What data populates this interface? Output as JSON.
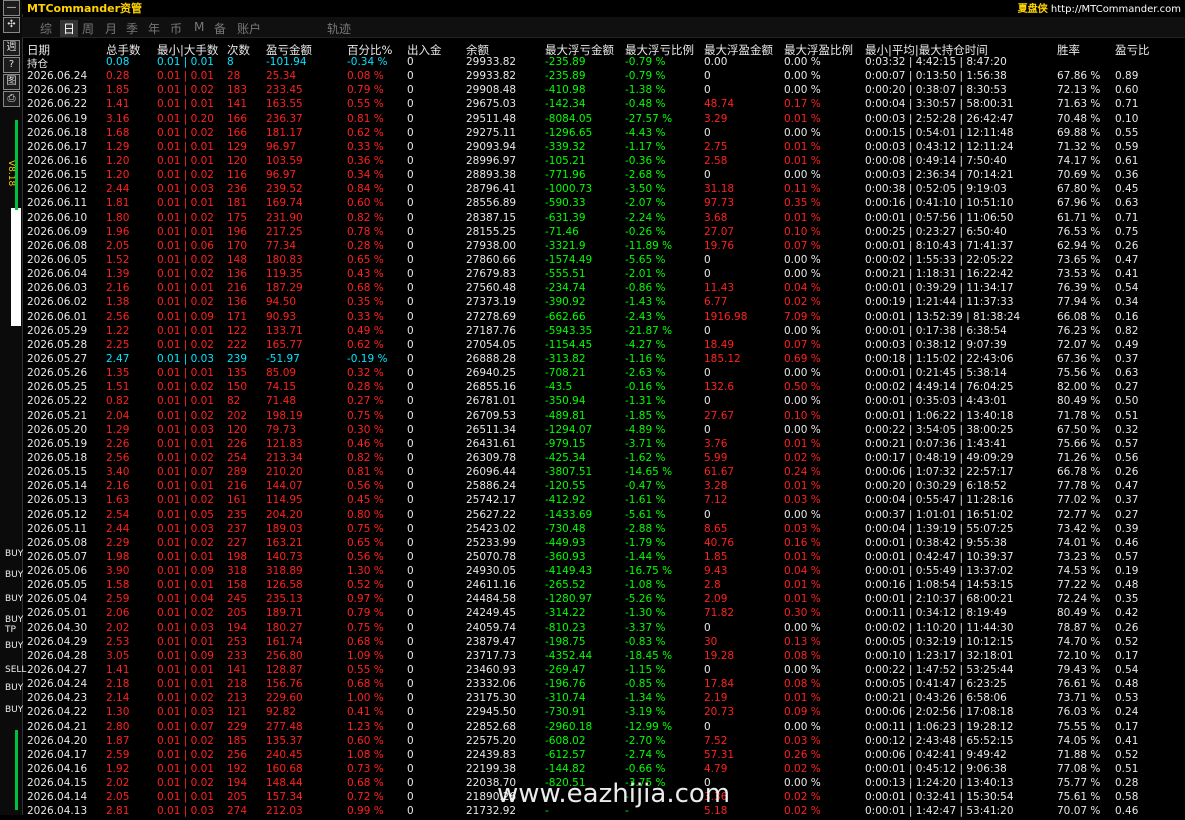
{
  "app": {
    "brand": "MTCommander资管",
    "brand_right_cn": "夏盘侠",
    "brand_right_url": "http://MTCommander.com"
  },
  "tabs": [
    {
      "label": "综",
      "active": false
    },
    {
      "label": "日",
      "active": true
    },
    {
      "label": "周",
      "active": false
    },
    {
      "label": "月",
      "active": false
    },
    {
      "label": "季",
      "active": false
    },
    {
      "label": "年",
      "active": false
    },
    {
      "label": "币",
      "active": false
    },
    {
      "label": "M",
      "active": false
    },
    {
      "label": "备",
      "active": false
    },
    {
      "label": "账户",
      "active": false
    }
  ],
  "extra_tab": "轨迹",
  "sidebar": {
    "version": "V8.18",
    "buttons": [
      "✣",
      "週",
      "?",
      "图",
      "⎙"
    ],
    "trade_tags": [
      "BUY",
      "BUY",
      "BUY",
      "BUY TP",
      "BUY",
      "SELL",
      "BUY",
      "BUY"
    ]
  },
  "columns": [
    "日期",
    "总手数",
    "最小|大手数",
    "次数",
    "盈亏金额",
    "百分比%",
    "出入金",
    "余额",
    "最大浮亏金额",
    "最大浮亏比例",
    "最大浮盈金额",
    "最大浮盈比例",
    "最小|平均|最大持仓时间",
    "胜率",
    "盈亏比"
  ],
  "holding": [
    "持仓",
    "0.08",
    "0.01 | 0.01",
    "8",
    "-101.94",
    "-0.34 %",
    "0",
    "29933.82",
    "-235.89",
    "-0.79 %",
    "0.00",
    "0.00 %",
    "0:03:32 | 4:42:15 | 8:47:20",
    "",
    ""
  ],
  "rows": [
    [
      "2026.06.24",
      "0.28",
      "0.01 | 0.01",
      "28",
      "25.34",
      "0.08 %",
      "0",
      "29933.82",
      "-235.89",
      "-0.79 %",
      "0",
      "0.00 %",
      "0:00:07 | 0:13:50 | 1:56:38",
      "67.86 %",
      "0.89"
    ],
    [
      "2026.06.23",
      "1.85",
      "0.01 | 0.02",
      "183",
      "233.45",
      "0.79 %",
      "0",
      "29908.48",
      "-410.98",
      "-1.38 %",
      "0",
      "0.00 %",
      "0:00:20 | 0:38:07 | 8:30:53",
      "72.13 %",
      "0.60"
    ],
    [
      "2026.06.22",
      "1.41",
      "0.01 | 0.01",
      "141",
      "163.55",
      "0.55 %",
      "0",
      "29675.03",
      "-142.34",
      "-0.48 %",
      "48.74",
      "0.17 %",
      "0:00:04 | 3:30:57 | 58:00:31",
      "71.63 %",
      "0.71"
    ],
    [
      "2026.06.19",
      "3.16",
      "0.01 | 0.20",
      "166",
      "236.37",
      "0.81 %",
      "0",
      "29511.48",
      "-8084.05",
      "-27.57 %",
      "3.29",
      "0.01 %",
      "0:00:03 | 2:52:28 | 26:42:47",
      "70.48 %",
      "0.10"
    ],
    [
      "2026.06.18",
      "1.68",
      "0.01 | 0.02",
      "166",
      "181.17",
      "0.62 %",
      "0",
      "29275.11",
      "-1296.65",
      "-4.43 %",
      "0",
      "0.00 %",
      "0:00:15 | 0:54:01 | 12:11:48",
      "69.88 %",
      "0.55"
    ],
    [
      "2026.06.17",
      "1.29",
      "0.01 | 0.01",
      "129",
      "96.97",
      "0.33 %",
      "0",
      "29093.94",
      "-339.32",
      "-1.17 %",
      "2.75",
      "0.01 %",
      "0:00:03 | 0:43:12 | 12:11:24",
      "71.32 %",
      "0.59"
    ],
    [
      "2026.06.16",
      "1.20",
      "0.01 | 0.01",
      "120",
      "103.59",
      "0.36 %",
      "0",
      "28996.97",
      "-105.21",
      "-0.36 %",
      "2.58",
      "0.01 %",
      "0:00:08 | 0:49:14 | 7:50:40",
      "74.17 %",
      "0.61"
    ],
    [
      "2026.06.15",
      "1.20",
      "0.01 | 0.02",
      "116",
      "96.97",
      "0.34 %",
      "0",
      "28893.38",
      "-771.96",
      "-2.68 %",
      "0",
      "0.00 %",
      "0:00:03 | 2:36:34 | 70:14:21",
      "70.69 %",
      "0.36"
    ],
    [
      "2026.06.12",
      "2.44",
      "0.01 | 0.03",
      "236",
      "239.52",
      "0.84 %",
      "0",
      "28796.41",
      "-1000.73",
      "-3.50 %",
      "31.18",
      "0.11 %",
      "0:00:38 | 0:52:05 | 9:19:03",
      "67.80 %",
      "0.45"
    ],
    [
      "2026.06.11",
      "1.81",
      "0.01 | 0.01",
      "181",
      "169.74",
      "0.60 %",
      "0",
      "28556.89",
      "-590.33",
      "-2.07 %",
      "97.73",
      "0.35 %",
      "0:00:16 | 0:41:10 | 10:51:10",
      "67.96 %",
      "0.63"
    ],
    [
      "2026.06.10",
      "1.80",
      "0.01 | 0.02",
      "175",
      "231.90",
      "0.82 %",
      "0",
      "28387.15",
      "-631.39",
      "-2.24 %",
      "3.68",
      "0.01 %",
      "0:00:01 | 0:57:56 | 11:06:50",
      "61.71 %",
      "0.71"
    ],
    [
      "2026.06.09",
      "1.96",
      "0.01 | 0.01",
      "196",
      "217.25",
      "0.78 %",
      "0",
      "28155.25",
      "-71.46",
      "-0.26 %",
      "27.07",
      "0.10 %",
      "0:00:25 | 0:23:27 | 6:50:40",
      "76.53 %",
      "0.75"
    ],
    [
      "2026.06.08",
      "2.05",
      "0.01 | 0.06",
      "170",
      "77.34",
      "0.28 %",
      "0",
      "27938.00",
      "-3321.9",
      "-11.89 %",
      "19.76",
      "0.07 %",
      "0:00:01 | 8:10:43 | 71:41:37",
      "62.94 %",
      "0.26"
    ],
    [
      "2026.06.05",
      "1.52",
      "0.01 | 0.02",
      "148",
      "180.83",
      "0.65 %",
      "0",
      "27860.66",
      "-1574.49",
      "-5.65 %",
      "0",
      "0.00 %",
      "0:00:02 | 1:55:33 | 22:05:22",
      "73.65 %",
      "0.47"
    ],
    [
      "2026.06.04",
      "1.39",
      "0.01 | 0.02",
      "136",
      "119.35",
      "0.43 %",
      "0",
      "27679.83",
      "-555.51",
      "-2.01 %",
      "0",
      "0.00 %",
      "0:00:21 | 1:18:31 | 16:22:42",
      "73.53 %",
      "0.41"
    ],
    [
      "2026.06.03",
      "2.16",
      "0.01 | 0.01",
      "216",
      "187.29",
      "0.68 %",
      "0",
      "27560.48",
      "-234.74",
      "-0.86 %",
      "11.43",
      "0.04 %",
      "0:00:01 | 0:39:29 | 11:34:17",
      "76.39 %",
      "0.54"
    ],
    [
      "2026.06.02",
      "1.38",
      "0.01 | 0.02",
      "136",
      "94.50",
      "0.35 %",
      "0",
      "27373.19",
      "-390.92",
      "-1.43 %",
      "6.77",
      "0.02 %",
      "0:00:19 | 1:21:44 | 11:37:33",
      "77.94 %",
      "0.34"
    ],
    [
      "2026.06.01",
      "2.56",
      "0.01 | 0.09",
      "171",
      "90.93",
      "0.33 %",
      "0",
      "27278.69",
      "-662.66",
      "-2.43 %",
      "1916.98",
      "7.09 %",
      "0:00:01 | 13:52:39 | 81:38:24",
      "66.08 %",
      "0.16"
    ],
    [
      "2026.05.29",
      "1.22",
      "0.01 | 0.01",
      "122",
      "133.71",
      "0.49 %",
      "0",
      "27187.76",
      "-5943.35",
      "-21.87 %",
      "0",
      "0.00 %",
      "0:00:01 | 0:17:38 | 6:38:54",
      "76.23 %",
      "0.82"
    ],
    [
      "2026.05.28",
      "2.25",
      "0.01 | 0.02",
      "222",
      "165.77",
      "0.62 %",
      "0",
      "27054.05",
      "-1154.45",
      "-4.27 %",
      "18.49",
      "0.07 %",
      "0:00:03 | 0:38:12 | 9:07:39",
      "72.07 %",
      "0.49"
    ],
    [
      "2026.05.27",
      "2.47",
      "0.01 | 0.03",
      "239",
      "-51.97",
      "-0.19 %",
      "0",
      "26888.28",
      "-313.82",
      "-1.16 %",
      "185.12",
      "0.69 %",
      "0:00:18 | 1:15:02 | 22:43:06",
      "67.36 %",
      "0.37"
    ],
    [
      "2026.05.26",
      "1.35",
      "0.01 | 0.01",
      "135",
      "85.09",
      "0.32 %",
      "0",
      "26940.25",
      "-708.21",
      "-2.63 %",
      "0",
      "0.00 %",
      "0:00:01 | 0:21:45 | 5:38:14",
      "75.56 %",
      "0.63"
    ],
    [
      "2026.05.25",
      "1.51",
      "0.01 | 0.02",
      "150",
      "74.15",
      "0.28 %",
      "0",
      "26855.16",
      "-43.5",
      "-0.16 %",
      "132.6",
      "0.50 %",
      "0:00:02 | 4:49:14 | 76:04:25",
      "82.00 %",
      "0.27"
    ],
    [
      "2026.05.22",
      "0.82",
      "0.01 | 0.01",
      "82",
      "71.48",
      "0.27 %",
      "0",
      "26781.01",
      "-350.94",
      "-1.31 %",
      "0",
      "0.00 %",
      "0:00:01 | 0:35:03 | 4:43:01",
      "80.49 %",
      "0.50"
    ],
    [
      "2026.05.21",
      "2.04",
      "0.01 | 0.02",
      "202",
      "198.19",
      "0.75 %",
      "0",
      "26709.53",
      "-489.81",
      "-1.85 %",
      "27.67",
      "0.10 %",
      "0:00:01 | 1:06:22 | 13:40:18",
      "71.78 %",
      "0.51"
    ],
    [
      "2026.05.20",
      "1.29",
      "0.01 | 0.03",
      "120",
      "79.73",
      "0.30 %",
      "0",
      "26511.34",
      "-1294.07",
      "-4.89 %",
      "0",
      "0.00 %",
      "0:00:22 | 3:54:05 | 38:00:25",
      "67.50 %",
      "0.32"
    ],
    [
      "2026.05.19",
      "2.26",
      "0.01 | 0.01",
      "226",
      "121.83",
      "0.46 %",
      "0",
      "26431.61",
      "-979.15",
      "-3.71 %",
      "3.76",
      "0.01 %",
      "0:00:21 | 0:07:36 | 1:43:41",
      "75.66 %",
      "0.57"
    ],
    [
      "2026.05.18",
      "2.56",
      "0.01 | 0.02",
      "254",
      "213.34",
      "0.82 %",
      "0",
      "26309.78",
      "-425.34",
      "-1.62 %",
      "5.99",
      "0.02 %",
      "0:00:17 | 0:48:19 | 49:09:29",
      "71.26 %",
      "0.56"
    ],
    [
      "2026.05.15",
      "3.40",
      "0.01 | 0.07",
      "289",
      "210.20",
      "0.81 %",
      "0",
      "26096.44",
      "-3807.51",
      "-14.65 %",
      "61.67",
      "0.24 %",
      "0:00:06 | 1:07:32 | 22:57:17",
      "66.78 %",
      "0.26"
    ],
    [
      "2026.05.14",
      "2.16",
      "0.01 | 0.01",
      "216",
      "144.07",
      "0.56 %",
      "0",
      "25886.24",
      "-120.55",
      "-0.47 %",
      "3.28",
      "0.01 %",
      "0:00:20 | 0:30:29 | 6:18:52",
      "77.78 %",
      "0.47"
    ],
    [
      "2026.05.13",
      "1.63",
      "0.01 | 0.02",
      "161",
      "114.95",
      "0.45 %",
      "0",
      "25742.17",
      "-412.92",
      "-1.61 %",
      "7.12",
      "0.03 %",
      "0:00:04 | 0:55:47 | 11:28:16",
      "77.02 %",
      "0.37"
    ],
    [
      "2026.05.12",
      "2.54",
      "0.01 | 0.05",
      "235",
      "204.20",
      "0.80 %",
      "0",
      "25627.22",
      "-1433.69",
      "-5.61 %",
      "0",
      "0.00 %",
      "0:00:37 | 1:01:01 | 16:51:02",
      "72.77 %",
      "0.27"
    ],
    [
      "2026.05.11",
      "2.44",
      "0.01 | 0.03",
      "237",
      "189.03",
      "0.75 %",
      "0",
      "25423.02",
      "-730.48",
      "-2.88 %",
      "8.65",
      "0.03 %",
      "0:00:04 | 1:39:19 | 55:07:25",
      "73.42 %",
      "0.39"
    ],
    [
      "2026.05.08",
      "2.29",
      "0.01 | 0.02",
      "227",
      "163.21",
      "0.65 %",
      "0",
      "25233.99",
      "-449.93",
      "-1.79 %",
      "40.76",
      "0.16 %",
      "0:00:01 | 0:38:42 | 9:55:38",
      "74.01 %",
      "0.46"
    ],
    [
      "2026.05.07",
      "1.98",
      "0.01 | 0.01",
      "198",
      "140.73",
      "0.56 %",
      "0",
      "25070.78",
      "-360.93",
      "-1.44 %",
      "1.85",
      "0.01 %",
      "0:00:01 | 0:42:47 | 10:39:37",
      "73.23 %",
      "0.57"
    ],
    [
      "2026.05.06",
      "3.90",
      "0.01 | 0.09",
      "318",
      "318.89",
      "1.30 %",
      "0",
      "24930.05",
      "-4149.43",
      "-16.75 %",
      "9.43",
      "0.04 %",
      "0:00:01 | 0:55:49 | 13:37:02",
      "74.53 %",
      "0.19"
    ],
    [
      "2026.05.05",
      "1.58",
      "0.01 | 0.01",
      "158",
      "126.58",
      "0.52 %",
      "0",
      "24611.16",
      "-265.52",
      "-1.08 %",
      "2.8",
      "0.01 %",
      "0:00:16 | 1:08:54 | 14:53:15",
      "77.22 %",
      "0.48"
    ],
    [
      "2026.05.04",
      "2.59",
      "0.01 | 0.04",
      "245",
      "235.13",
      "0.97 %",
      "0",
      "24484.58",
      "-1280.97",
      "-5.26 %",
      "2.09",
      "0.01 %",
      "0:00:01 | 2:10:37 | 68:00:21",
      "72.24 %",
      "0.35"
    ],
    [
      "2026.05.01",
      "2.06",
      "0.01 | 0.02",
      "205",
      "189.71",
      "0.79 %",
      "0",
      "24249.45",
      "-314.22",
      "-1.30 %",
      "71.82",
      "0.30 %",
      "0:00:11 | 0:34:12 | 8:19:49",
      "80.49 %",
      "0.42"
    ],
    [
      "2026.04.30",
      "2.02",
      "0.01 | 0.03",
      "194",
      "180.27",
      "0.75 %",
      "0",
      "24059.74",
      "-810.23",
      "-3.37 %",
      "0",
      "0.00 %",
      "0:00:02 | 1:10:20 | 11:44:30",
      "78.87 %",
      "0.26"
    ],
    [
      "2026.04.29",
      "2.53",
      "0.01 | 0.01",
      "253",
      "161.74",
      "0.68 %",
      "0",
      "23879.47",
      "-198.75",
      "-0.83 %",
      "30",
      "0.13 %",
      "0:00:05 | 0:32:19 | 10:12:15",
      "74.70 %",
      "0.52"
    ],
    [
      "2026.04.28",
      "3.05",
      "0.01 | 0.09",
      "233",
      "256.80",
      "1.09 %",
      "0",
      "23717.73",
      "-4352.44",
      "-18.45 %",
      "19.28",
      "0.08 %",
      "0:00:10 | 1:23:17 | 32:18:01",
      "72.10 %",
      "0.17"
    ],
    [
      "2026.04.27",
      "1.41",
      "0.01 | 0.01",
      "141",
      "128.87",
      "0.55 %",
      "0",
      "23460.93",
      "-269.47",
      "-1.15 %",
      "0",
      "0.00 %",
      "0:00:22 | 1:47:52 | 53:25:44",
      "79.43 %",
      "0.54"
    ],
    [
      "2026.04.24",
      "2.18",
      "0.01 | 0.01",
      "218",
      "156.76",
      "0.68 %",
      "0",
      "23332.06",
      "-196.76",
      "-0.85 %",
      "17.84",
      "0.08 %",
      "0:00:05 | 0:41:47 | 6:23:25",
      "76.61 %",
      "0.48"
    ],
    [
      "2026.04.23",
      "2.14",
      "0.01 | 0.02",
      "213",
      "229.60",
      "1.00 %",
      "0",
      "23175.30",
      "-310.74",
      "-1.34 %",
      "2.19",
      "0.01 %",
      "0:00:21 | 0:43:26 | 6:58:06",
      "73.71 %",
      "0.53"
    ],
    [
      "2026.04.22",
      "1.30",
      "0.01 | 0.03",
      "121",
      "92.82",
      "0.41 %",
      "0",
      "22945.50",
      "-730.91",
      "-3.19 %",
      "20.73",
      "0.09 %",
      "0:00:06 | 2:02:56 | 17:08:18",
      "76.03 %",
      "0.24"
    ],
    [
      "2026.04.21",
      "2.80",
      "0.01 | 0.07",
      "229",
      "277.48",
      "1.23 %",
      "0",
      "22852.68",
      "-2960.18",
      "-12.99 %",
      "0",
      "0.00 %",
      "0:00:11 | 1:06:23 | 19:28:12",
      "75.55 %",
      "0.17"
    ],
    [
      "2026.04.20",
      "1.87",
      "0.01 | 0.02",
      "185",
      "135.37",
      "0.60 %",
      "0",
      "22575.20",
      "-608.02",
      "-2.70 %",
      "7.52",
      "0.03 %",
      "0:00:12 | 2:43:48 | 65:52:15",
      "74.05 %",
      "0.41"
    ],
    [
      "2026.04.17",
      "2.59",
      "0.01 | 0.02",
      "256",
      "240.45",
      "1.08 %",
      "0",
      "22439.83",
      "-612.57",
      "-2.74 %",
      "57.31",
      "0.26 %",
      "0:00:06 | 0:42:41 | 9:49:42",
      "71.88 %",
      "0.52"
    ],
    [
      "2026.04.16",
      "1.92",
      "0.01 | 0.01",
      "192",
      "160.68",
      "0.73 %",
      "0",
      "22199.38",
      "-144.82",
      "-0.66 %",
      "4.79",
      "0.02 %",
      "0:00:01 | 0:45:12 | 9:06:38",
      "77.08 %",
      "0.51"
    ],
    [
      "2026.04.15",
      "2.02",
      "0.01 | 0.02",
      "194",
      "148.44",
      "0.68 %",
      "0",
      "22038.70",
      "-820.51",
      "-3.75 %",
      "0",
      "0.00 %",
      "0:00:13 | 1:24:20 | 13:40:13",
      "75.77 %",
      "0.28"
    ],
    [
      "2026.04.14",
      "2.05",
      "0.01 | 0.01",
      "205",
      "157.34",
      "0.72 %",
      "0",
      "21890.26",
      "-",
      "-",
      "3.36",
      "0.02 %",
      "0:00:01 | 0:32:41 | 15:30:54",
      "75.61 %",
      "0.58"
    ],
    [
      "2026.04.13",
      "2.81",
      "0.01 | 0.03",
      "274",
      "212.03",
      "0.99 %",
      "0",
      "21732.92",
      "-",
      "-",
      "5.18",
      "0.02 %",
      "0:00:01 | 1:42:47 | 53:41:20",
      "70.07 %",
      "0.46"
    ]
  ],
  "colors": {
    "profit": "#ff2020",
    "loss": "#00e6ff",
    "floating_loss": "#00ff00",
    "text": "#e8e8e8"
  },
  "watermark": "www.eazhijia.com"
}
